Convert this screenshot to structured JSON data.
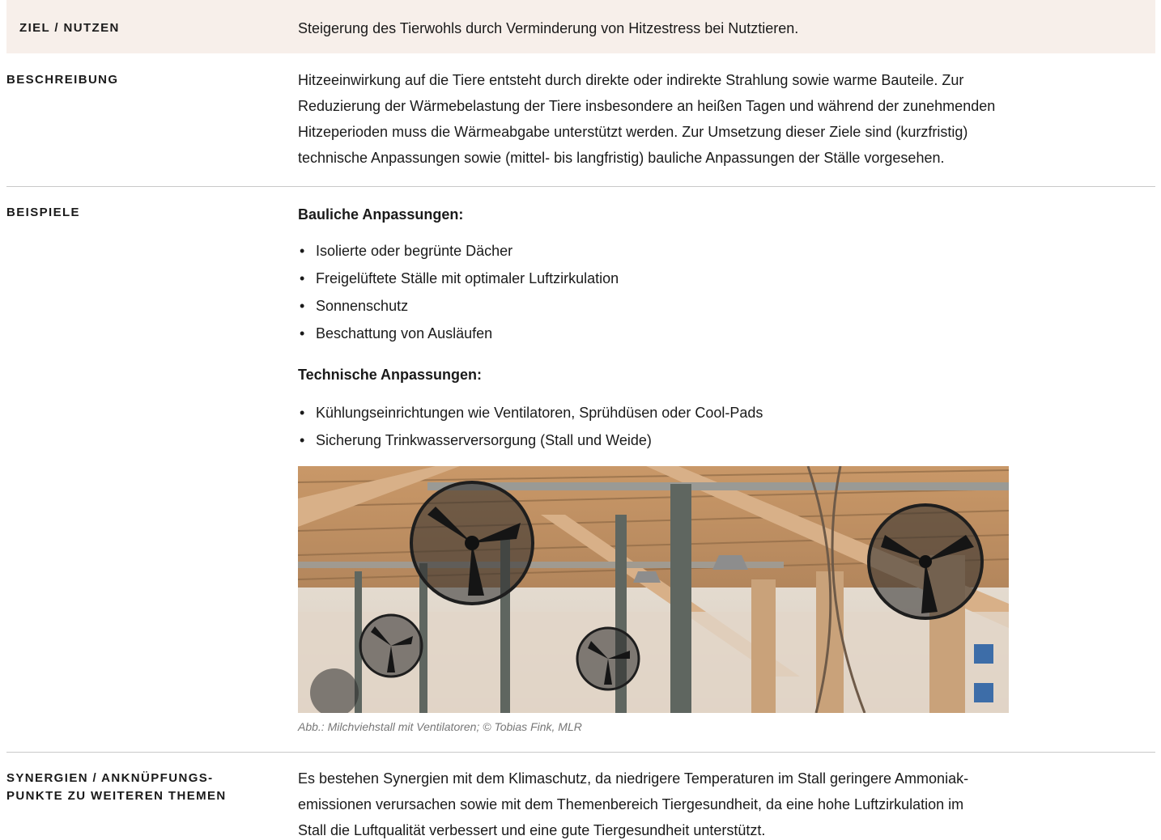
{
  "ziel": {
    "label": "ZIEL / NUTZEN",
    "text": "Steigerung des Tierwohls durch Verminderung von Hitzestress bei Nutztieren."
  },
  "beschreibung": {
    "label": "BESCHREIBUNG",
    "lines": [
      "Hitzeeinwirkung auf die Tiere entsteht durch direkte oder indirekte Strahlung sowie warme Bauteile. Zur",
      "Reduzierung der Wärmebelastung der Tiere insbesondere an heißen Tagen und während der zunehmenden",
      "Hitzeperioden muss die Wärmeabgabe unterstützt werden. Zur Umsetzung dieser Ziele sind (kurzfristig)",
      "technische Anpassungen sowie (mittel- bis langfristig) bauliche Anpassungen der Ställe vorgesehen."
    ]
  },
  "beispiele": {
    "label": "BEISPIELE",
    "bauliche_heading": "Bauliche Anpassungen:",
    "bauliche_items": [
      "Isolierte oder begrünte Dächer",
      "Freigelüftete Ställe mit optimaler Luftzirkulation",
      "Sonnenschutz",
      "Beschattung von Ausläufen"
    ],
    "technische_heading": "Technische Anpassungen:",
    "technische_items": [
      "Kühlungseinrichtungen wie Ventilatoren, Sprühdüsen oder Cool-Pads",
      "Sicherung Trinkwasserversorgung (Stall und Weide)"
    ],
    "bullet": "•",
    "caption": "Abb.: Milchviehstall mit Ventilatoren; © Tobias Fink, MLR"
  },
  "synergien": {
    "label_line1": "SYNERGIEN / ANKNÜPFUNGS-",
    "label_line2": "PUNKTE ZU WEITEREN THEMEN",
    "lines": [
      "Es bestehen Synergien mit dem Klimaschutz, da niedrigere Temperaturen im Stall geringere Ammoniak-",
      "emissionen verursachen sowie mit dem Themenbereich Tiergesundheit, da eine hohe Luftzirkulation im",
      "Stall die Luftqualität verbessert und eine gute Tiergesundheit unterstützt."
    ]
  },
  "colors": {
    "highlight_row": "#f7efea",
    "divider": "#c9c9c9",
    "caption": "#777777"
  }
}
